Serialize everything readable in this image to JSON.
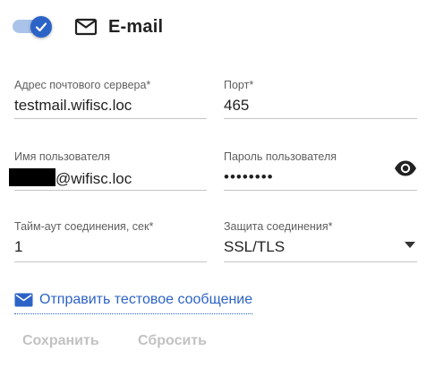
{
  "header": {
    "title": "E-mail",
    "toggle_on": true
  },
  "fields": {
    "server": {
      "label": "Адрес почтового сервера*",
      "value": "testmail.wifisc.loc"
    },
    "port": {
      "label": "Порт*",
      "value": "465"
    },
    "user": {
      "label": "Имя пользователя",
      "value_suffix": "@wifisc.loc"
    },
    "password": {
      "label": "Пароль пользователя",
      "value": "••••••••"
    },
    "timeout": {
      "label": "Тайм-аут соединения, сек*",
      "value": "1"
    },
    "security": {
      "label": "Защита соединения*",
      "value": "SSL/TLS"
    }
  },
  "test_link": {
    "label": "Отправить тестовое сообщение"
  },
  "buttons": {
    "save": "Сохранить",
    "reset": "Сбросить"
  },
  "colors": {
    "accent": "#2c63c6",
    "track": "#aac3ea",
    "disabled": "#c2c2c2"
  },
  "icons": [
    "check-icon",
    "envelope-outline-icon",
    "eye-icon",
    "caret-down-icon",
    "envelope-filled-icon"
  ]
}
